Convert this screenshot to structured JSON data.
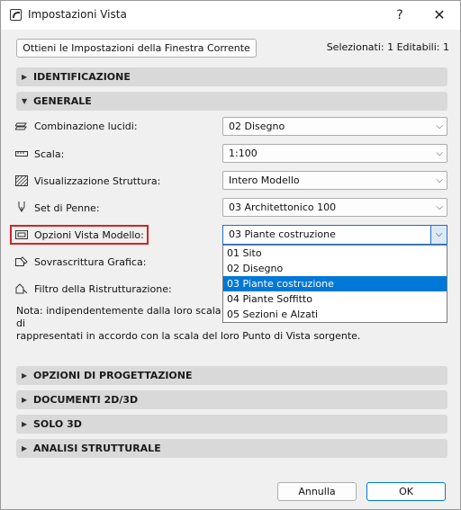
{
  "window": {
    "title": "Impostazioni Vista",
    "help_icon": "?",
    "close_icon": "✕"
  },
  "toolbar": {
    "get_settings_label": "Ottieni le Impostazioni della Finestra Corrente",
    "selection_status": "Selezionati: 1 Editabili: 1"
  },
  "sections_top": [
    {
      "label": "IDENTIFICAZIONE",
      "expanded": false
    },
    {
      "label": "GENERALE",
      "expanded": true
    }
  ],
  "general": {
    "layer_combination": {
      "label": "Combinazione lucidi:",
      "value": "02 Disegno"
    },
    "scale": {
      "label": "Scala:",
      "value": "1:100"
    },
    "structure_display": {
      "label": "Visualizzazione Struttura:",
      "value": "Intero Modello"
    },
    "pen_set": {
      "label": "Set di Penne:",
      "value": "03 Architettonico 100"
    },
    "model_view_options": {
      "label": "Opzioni Vista Modello:",
      "value": "03 Piante costruzione",
      "options": [
        "01 Sito",
        "02 Disegno",
        "03 Piante costruzione",
        "04 Piante Soffitto",
        "05 Sezioni e Alzati"
      ],
      "selected_index": 2
    },
    "graphic_override": {
      "label": "Sovrascrittura Grafica:"
    },
    "renovation_filter": {
      "label": "Filtro della Ristrutturazione:"
    },
    "note_line1": "Nota: indipendentemente dalla loro scala di",
    "note_line2": "rappresentati in accordo con la scala del loro Punto di Vista sorgente."
  },
  "sections_bottom": [
    {
      "label": "OPZIONI DI PROGETTAZIONE",
      "expanded": false
    },
    {
      "label": "DOCUMENTI 2D/3D",
      "expanded": false
    },
    {
      "label": "SOLO 3D",
      "expanded": false
    },
    {
      "label": "ANALISI STRUTTURALE",
      "expanded": false
    }
  ],
  "footer": {
    "cancel_label": "Annulla",
    "ok_label": "OK"
  }
}
